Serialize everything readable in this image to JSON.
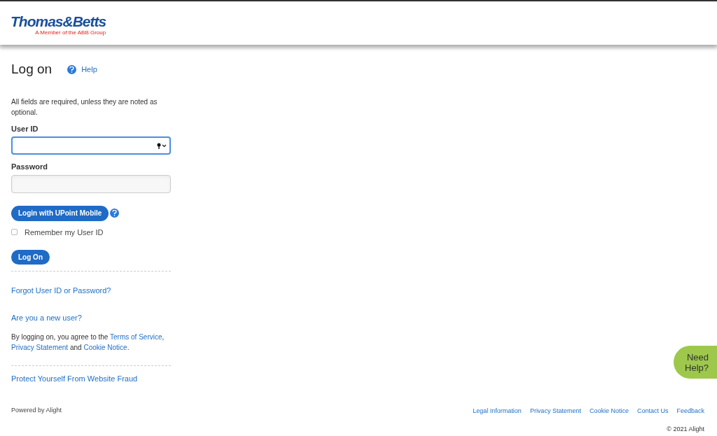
{
  "header": {
    "logo": "Thomas&Betts",
    "tagline": "A Member of the ABB Group"
  },
  "title": "Log on",
  "help_link": "Help",
  "intro": "All fields are required, unless they are noted as optional.",
  "fields": [
    {
      "label": "User ID",
      "focused": true,
      "kind": "autofill"
    },
    {
      "label": "Password",
      "focused": false,
      "kind": "plain"
    }
  ],
  "upoint_button": "Login with UPoint Mobile",
  "remember": {
    "label": "Remember my User ID",
    "checked": false
  },
  "logon_button": "Log On",
  "links": [
    "Forgot User ID or Password?",
    "Are you a new user?"
  ],
  "agreement": [
    {
      "kind": "text",
      "text": "By logging on, you agree to the "
    },
    {
      "kind": "link",
      "text": "Terms of Service"
    },
    {
      "kind": "text",
      "text": ", "
    },
    {
      "kind": "link",
      "text": "Privacy Statement"
    },
    {
      "kind": "text",
      "text": " and "
    },
    {
      "kind": "link",
      "text": "Cookie Notice"
    },
    {
      "kind": "text",
      "text": "."
    }
  ],
  "fraud_link": "Protect Yourself From Website Fraud",
  "need_help": "Need Help?",
  "footer": {
    "powered_by": "Powered by Alight",
    "links": [
      "Legal Information",
      "Privacy Statement",
      "Cookie Notice",
      "Contact Us",
      "Feedback"
    ],
    "copyright": "© 2021 Alight"
  }
}
